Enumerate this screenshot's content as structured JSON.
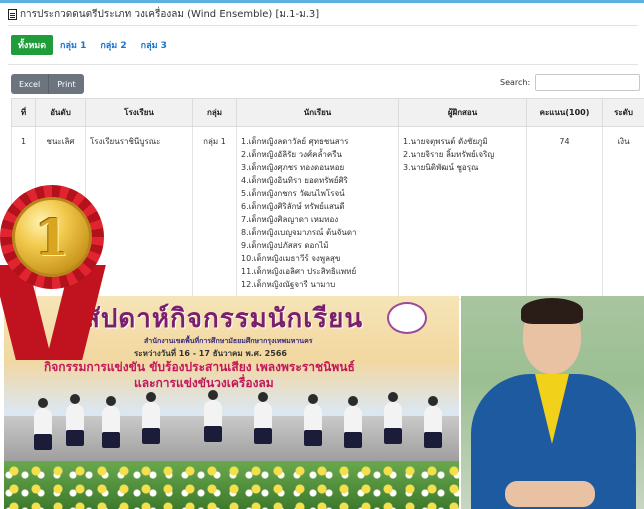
{
  "page": {
    "title": "การประกวดดนตรีประเภท วงเครื่องลม (Wind Ensemble) [ม.1-ม.3]"
  },
  "tabs": [
    {
      "label": "ทั้งหมด",
      "active": true
    },
    {
      "label": "กลุ่ม 1",
      "active": false
    },
    {
      "label": "กลุ่ม 2",
      "active": false
    },
    {
      "label": "กลุ่ม 3",
      "active": false
    }
  ],
  "toolbar": {
    "excel_label": "Excel",
    "print_label": "Print",
    "search_label": "Search:",
    "search_value": ""
  },
  "table": {
    "headers": [
      "ที่",
      "อันดับ",
      "โรงเรียน",
      "กลุ่ม",
      "นักเรียน",
      "ผู้ฝึกสอน",
      "คะแนน(100)",
      "ระดับ"
    ],
    "rows": [
      {
        "no": "1",
        "rank": "ชนะเลิศ",
        "school": "โรงเรียนราชินีบูรณะ",
        "group": "กลุ่ม 1",
        "students": [
          "1.เด็กหญิงลดาวัลย์ ศุทธชนสาร",
          "2.เด็กหญิงอัลิรัย วงศ์คล้ำครืน",
          "3.เด็กหญิงศุภชร ทองดอนหอย",
          "4.เด็กหญิงอินทิรา ยอดทรัพย์ศิริ",
          "5.เด็กหญิงกชกร วัฒนไพโรจน์",
          "6.เด็กหญิงศิริลักษ์ ทรัพย์แสนดี",
          "7.เด็กหญิงศิลญาดา เหมทอง",
          "8.เด็กหญิงเบญจมาภรณ์ ต้นจันดา",
          "9.เด็กหญิงปภัสสร ดอกไม้",
          "10.เด็กหญิงเมธาวีร์ จงพูลสุข",
          "11.เด็กหญิงเอลิศา ประสิทธิแพทย์",
          "12.เด็กหญิงณัฐจารี นามาบ"
        ],
        "coaches": [
          "1.นายจตุพรนต์ ดังชัยภูมิ",
          "2.นายจิราย ลิ้มทรัพย์เจริญ",
          "3.นายนิติพัฒน์ ชูอรุณ"
        ],
        "score": "74",
        "level": "เงิน"
      }
    ]
  },
  "medal": {
    "number": "1"
  },
  "poster": {
    "title": "สัปดาห์กิจกรรมนักเรียน",
    "subtitle": "สำนักงานเขตพื้นที่การศึกษามัธยมศึกษากรุงเทพมหานคร",
    "dates": "ระหว่างวันที่ 16 - 17 ธันวาคม พ.ศ. 2566",
    "line1": "กิจกรรมการแข่งขัน ขับร้องประสานเสียง เพลงพระราชนิพนธ์",
    "line2": "และการแข่งขันวงเครื่องลม"
  },
  "colors": {
    "accent_green": "#1f9d3a",
    "link_blue": "#1a73c8",
    "button_gray": "#6c757d"
  }
}
